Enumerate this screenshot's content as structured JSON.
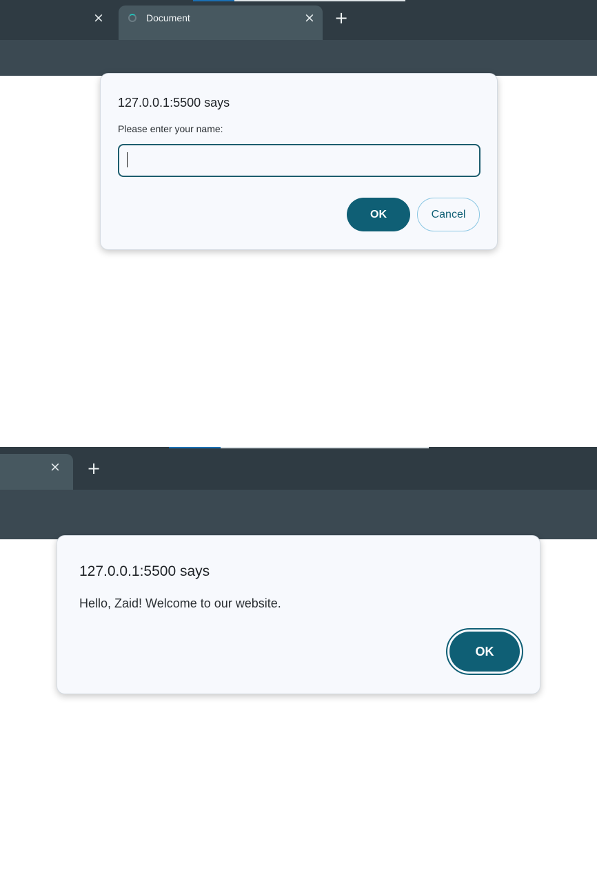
{
  "colors": {
    "tabstrip": "#2f3b43",
    "toolbar": "#3b4952",
    "active_tab": "#475860",
    "dialog_bg": "#f7f9fd",
    "accent": "#0f5f75",
    "progress_blue": "#1a6fb3"
  },
  "prompt_screen": {
    "tabs": [
      {
        "title": "",
        "close_icon": "×",
        "active": false
      },
      {
        "title": "Document",
        "close_icon": "×",
        "active": true,
        "favicon": "loading-spinner-icon"
      }
    ],
    "new_tab_icon": "+",
    "dialog": {
      "title": "127.0.0.1:5500 says",
      "message": "Please enter your name:",
      "input_value": "",
      "ok_label": "OK",
      "cancel_label": "Cancel"
    }
  },
  "alert_screen": {
    "tabs": [
      {
        "title": "",
        "close_icon": "×",
        "active": true
      }
    ],
    "new_tab_icon": "+",
    "dialog": {
      "title": "127.0.0.1:5500 says",
      "message": "Hello, Zaid! Welcome to our website.",
      "ok_label": "OK"
    }
  }
}
